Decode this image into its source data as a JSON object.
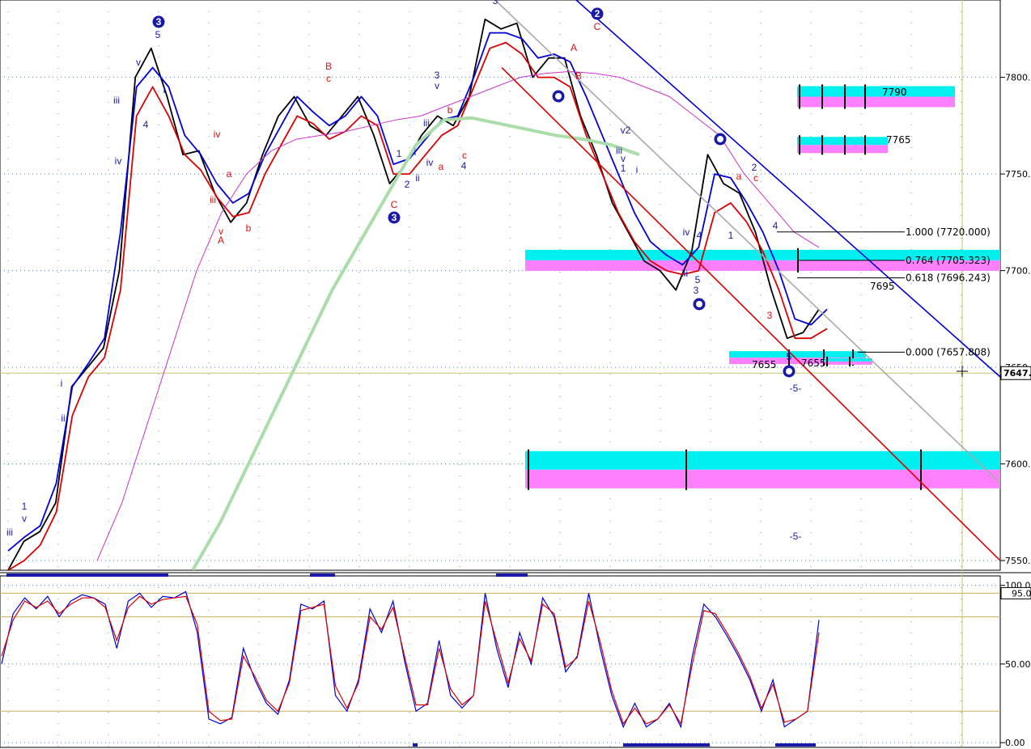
{
  "chart_data": [
    {
      "type": "line",
      "panel": "price",
      "ylim": [
        7545,
        7840
      ],
      "y_ticks": [
        "7800.",
        "7750.",
        "7700.",
        "7650.",
        "7600.",
        "7550."
      ],
      "current_price": "7647.",
      "grid": true,
      "fib_levels": [
        {
          "label": "1.000 (7720.000)",
          "value": 7720.0
        },
        {
          "label": "0.764 (7705.323)",
          "value": 7705.323
        },
        {
          "label": "0.618 (7696.243)",
          "value": 7696.243
        },
        {
          "label": "0.000 (7657.808)",
          "value": 7657.808
        }
      ],
      "zone_labels": [
        {
          "text": "7790",
          "value": 7790
        },
        {
          "text": "7765",
          "value": 7765
        },
        {
          "text": "7695",
          "value": 7695
        },
        {
          "text": "7655",
          "value": 7655
        },
        {
          "text": "7655",
          "value": 7655
        }
      ],
      "series": [
        {
          "color": "#000000",
          "values": [
            7545,
            7560,
            7565,
            7580,
            7640,
            7650,
            7660,
            7700,
            7800,
            7815,
            7790,
            7760,
            7762,
            7740,
            7725,
            7735,
            7760,
            7780,
            7790,
            7775,
            7770,
            7780,
            7790,
            7770,
            7745,
            7755,
            7770,
            7780,
            7775,
            7790,
            7830,
            7825,
            7828,
            7800,
            7810,
            7810,
            7780,
            7760,
            7735,
            7720,
            7705,
            7700,
            7690,
            7710,
            7760,
            7745,
            7740,
            7720,
            7690,
            7665,
            7668,
            7680
          ]
        },
        {
          "color": "#0000dd",
          "values": [
            7555,
            7562,
            7568,
            7590,
            7640,
            7652,
            7665,
            7720,
            7795,
            7805,
            7795,
            7770,
            7760,
            7745,
            7735,
            7740,
            7760,
            7775,
            7790,
            7782,
            7775,
            7780,
            7790,
            7780,
            7755,
            7758,
            7768,
            7778,
            7780,
            7800,
            7823,
            7823,
            7820,
            7810,
            7812,
            7808,
            7790,
            7770,
            7750,
            7730,
            7715,
            7708,
            7703,
            7712,
            7750,
            7748,
            7735,
            7720,
            7700,
            7675,
            7672,
            7680
          ]
        },
        {
          "color": "#dd0000",
          "values": [
            7545,
            7550,
            7558,
            7575,
            7625,
            7645,
            7655,
            7690,
            7780,
            7795,
            7780,
            7760,
            7752,
            7738,
            7728,
            7730,
            7750,
            7765,
            7780,
            7776,
            7768,
            7772,
            7780,
            7775,
            7750,
            7750,
            7760,
            7770,
            7775,
            7795,
            7815,
            7818,
            7812,
            7800,
            7800,
            7795,
            7770,
            7750,
            7730,
            7715,
            7705,
            7700,
            7698,
            7700,
            7730,
            7735,
            7725,
            7710,
            7690,
            7665,
            7665,
            7670
          ]
        },
        {
          "color": "#cc33cc",
          "values": [
            7550,
            7580,
            7620,
            7660,
            7700,
            7730,
            7750,
            7762,
            7768,
            7770,
            7772,
            7775,
            7778,
            7780,
            7785,
            7790,
            7795,
            7800,
            7802,
            7803,
            7802,
            7800,
            7795,
            7790,
            7780,
            7770,
            7750,
            7735,
            7720,
            7712
          ]
        },
        {
          "color": "#aaddaa",
          "values": [
            7545,
            7570,
            7600,
            7630,
            7660,
            7690,
            7715,
            7740,
            7765,
            7778,
            7779,
            7776,
            7773,
            7770,
            7768,
            7765,
            7760
          ]
        },
        {
          "color": "#0000dd",
          "values": [
            7840,
            7645
          ]
        },
        {
          "color": "#dd0000",
          "values": [
            7805,
            7550
          ]
        },
        {
          "color": "#aaaaaa",
          "values": [
            7840,
            7590
          ]
        }
      ],
      "wave_labels": [
        "3",
        "5",
        "3",
        "v",
        "iii",
        "iv",
        "i",
        "4",
        "i",
        "ii",
        "1",
        "v",
        "iii",
        "B",
        "c",
        "iv",
        "a",
        "iii",
        "v",
        "A",
        "b",
        "3",
        "v",
        "iii",
        "b",
        "1",
        "i",
        "ii",
        "iv",
        "a",
        "c",
        "4",
        "C",
        "2",
        "3",
        "A",
        "B",
        "C",
        "2",
        "v2",
        "iii",
        "v",
        "1",
        "i",
        "4",
        "iv",
        "iii",
        "5",
        "3",
        "a",
        "2",
        "c",
        "4",
        "1",
        "3",
        "5",
        "-5-",
        "-5-"
      ]
    },
    {
      "type": "line",
      "panel": "oscillator",
      "ylim": [
        -3,
        106
      ],
      "y_ticks": [
        "100.0",
        "50.00",
        "0.00"
      ],
      "reference_label": "95.0",
      "grid": true,
      "series": [
        {
          "color": "#0000dd",
          "values": [
            50,
            82,
            92,
            85,
            93,
            80,
            90,
            94,
            92,
            88,
            60,
            90,
            95,
            86,
            93,
            92,
            96,
            70,
            15,
            12,
            16,
            60,
            40,
            25,
            18,
            40,
            88,
            85,
            90,
            30,
            20,
            40,
            85,
            70,
            90,
            52,
            20,
            25,
            65,
            30,
            22,
            30,
            95,
            60,
            35,
            70,
            50,
            92,
            80,
            45,
            55,
            95,
            60,
            30,
            10,
            25,
            10,
            15,
            25,
            10,
            55,
            88,
            80,
            68,
            55,
            40,
            20,
            40,
            10,
            15,
            20,
            78
          ]
        },
        {
          "color": "#dd0000",
          "values": [
            55,
            78,
            90,
            86,
            90,
            82,
            88,
            92,
            92,
            86,
            65,
            86,
            93,
            88,
            91,
            92,
            93,
            75,
            20,
            14,
            15,
            55,
            42,
            27,
            20,
            38,
            84,
            86,
            88,
            36,
            22,
            38,
            80,
            72,
            86,
            55,
            24,
            24,
            60,
            34,
            24,
            30,
            90,
            64,
            38,
            66,
            52,
            88,
            82,
            48,
            54,
            90,
            64,
            33,
            12,
            22,
            12,
            15,
            24,
            12,
            50,
            84,
            82,
            70,
            57,
            42,
            22,
            37,
            13,
            15,
            20,
            70
          ]
        }
      ]
    }
  ]
}
